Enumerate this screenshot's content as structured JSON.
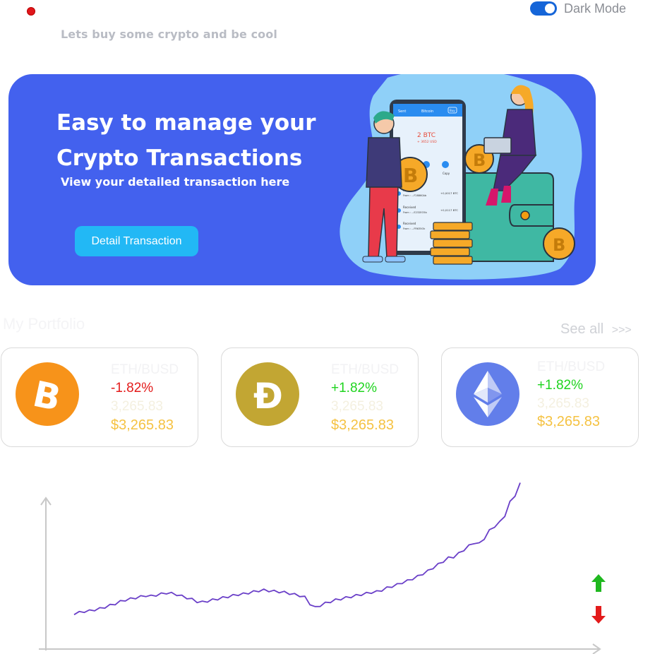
{
  "header": {
    "tagline": "Lets buy some crypto and be cool",
    "dark_mode_label": "Dark Mode",
    "dark_mode_on": true
  },
  "banner": {
    "title_line1": "Easy to manage your",
    "title_line2": "Crypto Transactions",
    "subtitle": "View your detailed transaction here",
    "button_label": "Detail Transaction",
    "phone": {
      "header_left": "Sent",
      "header_center": "Bitcoin",
      "header_right": "Buy",
      "amount": "2 BTC",
      "amount_usd": "+ 3652 USD",
      "copy_label": "Copy",
      "rows": [
        {
          "type": "Received",
          "from": "From : ...F28860Ab",
          "value": "+0,0017 BTC"
        },
        {
          "type": "Received",
          "from": "From : ...E232EO5b",
          "value": "+0,0117 BTC"
        },
        {
          "type": "Received",
          "from": "From : ...FR635Ok",
          "value": "+0,0117 BTC"
        }
      ]
    }
  },
  "portfolio": {
    "title": "My Portfolio",
    "see_all": "See all",
    "see_all_arrows": ">>>",
    "cards": [
      {
        "coin": "bitcoin",
        "icon": "bitcoin-icon",
        "color": "#f7931a",
        "pair": "ETH/BUSD",
        "change": "-1.82%",
        "change_color": "#e31b1b",
        "ghost_price": "3,265.83",
        "price": "$3,265.83"
      },
      {
        "coin": "dogecoin",
        "icon": "dogecoin-icon",
        "color": "#c2a633",
        "pair": "ETH/BUSD",
        "change": "+1.82%",
        "change_color": "#1fd41f",
        "ghost_price": "3,265.83",
        "price": "$3,265.83"
      },
      {
        "coin": "ethereum",
        "icon": "ethereum-icon",
        "color": "#627eea",
        "pair": "ETH/BUSD",
        "change": "+1.82%",
        "change_color": "#1fd41f",
        "ghost_price": "3,265.83",
        "price": "$3,265.83"
      }
    ]
  },
  "chart_data": {
    "type": "line",
    "line_color": "#6a3fc8",
    "axis_color": "#c8c8c8",
    "grid": false,
    "y": [
      8,
      10,
      12,
      13,
      15,
      17,
      20,
      23,
      26,
      30,
      33,
      35,
      37,
      39,
      41,
      40,
      42,
      44,
      46,
      45,
      43,
      40,
      37,
      34,
      30,
      29,
      31,
      33,
      35,
      37,
      39,
      41,
      43,
      44,
      46,
      48,
      50,
      51,
      50,
      49,
      48,
      47,
      45,
      43,
      41,
      38,
      26,
      19,
      23,
      27,
      30,
      33,
      35,
      37,
      39,
      41,
      43,
      45,
      47,
      48,
      51,
      55,
      58,
      61,
      65,
      68,
      72,
      76,
      81,
      86,
      92,
      98,
      104,
      110,
      112,
      118,
      125,
      132,
      138,
      136,
      146,
      160,
      168,
      175,
      188,
      212,
      225,
      246
    ],
    "up_arrow_color": "#1fb81f",
    "down_arrow_color": "#e31b1b"
  }
}
